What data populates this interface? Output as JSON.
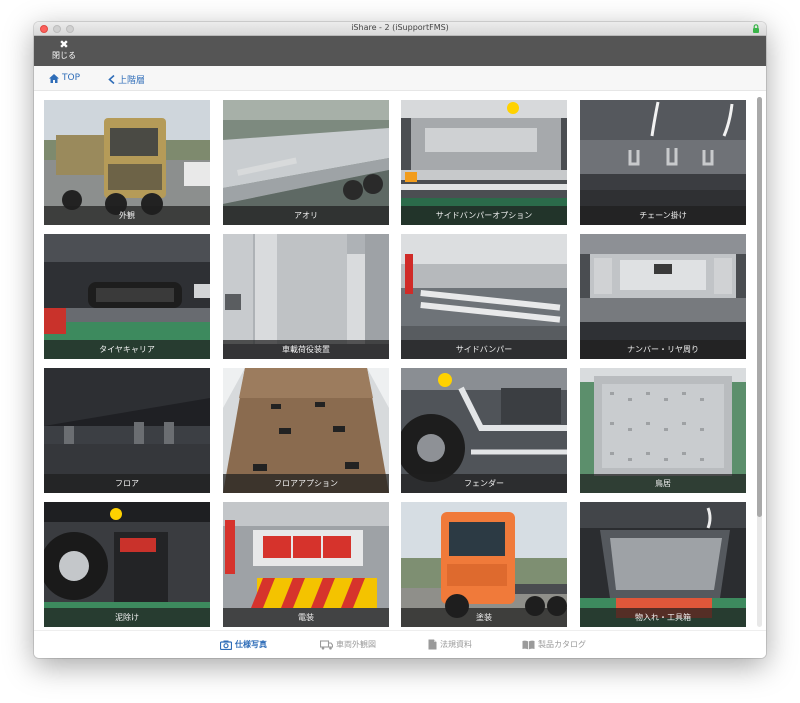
{
  "window": {
    "title": "iShare - 2 (iSupportFMS)"
  },
  "toolbar": {
    "close_label": "閉じる"
  },
  "nav": {
    "top_label": "TOP",
    "up_label": "上階層"
  },
  "tiles": [
    {
      "label": "外観"
    },
    {
      "label": "アオリ"
    },
    {
      "label": "サイドバンパーオプション"
    },
    {
      "label": "チェーン掛け"
    },
    {
      "label": "タイヤキャリア"
    },
    {
      "label": "車載荷役装置"
    },
    {
      "label": "サイドバンパー"
    },
    {
      "label": "ナンバー・リヤ周り"
    },
    {
      "label": "フロア"
    },
    {
      "label": "フロアアプション"
    },
    {
      "label": "フェンダー"
    },
    {
      "label": "鳥居"
    },
    {
      "label": "泥除け"
    },
    {
      "label": "電装"
    },
    {
      "label": "塗装"
    },
    {
      "label": "物入れ・工具箱"
    }
  ],
  "tabs": [
    {
      "label": "仕様写真",
      "active": true
    },
    {
      "label": "車両外観図"
    },
    {
      "label": "法規資料"
    },
    {
      "label": "製品カタログ"
    }
  ],
  "colors": {
    "accent": "#2f6db8",
    "toolbar": "#555555"
  }
}
